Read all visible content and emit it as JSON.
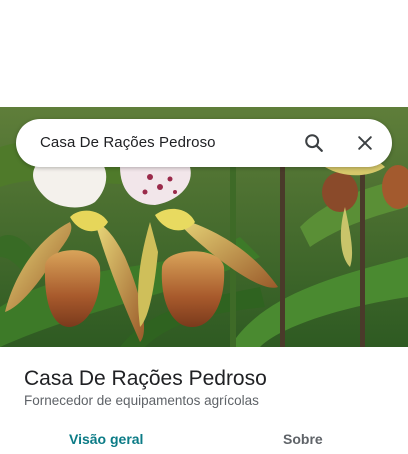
{
  "search": {
    "query": "Casa De Rações Pedroso",
    "search_icon": "search-icon",
    "close_icon": "close-icon"
  },
  "hero": {
    "image": "orchid-photo"
  },
  "place": {
    "name": "Casa De Rações Pedroso",
    "category": "Fornecedor de equipamentos agrícolas"
  },
  "tabs": [
    {
      "label": "Visão geral",
      "active": true
    },
    {
      "label": "Sobre",
      "active": false
    }
  ],
  "colors": {
    "accent": "#0b7b86",
    "text_primary": "#202124",
    "text_secondary": "#5f6368"
  }
}
